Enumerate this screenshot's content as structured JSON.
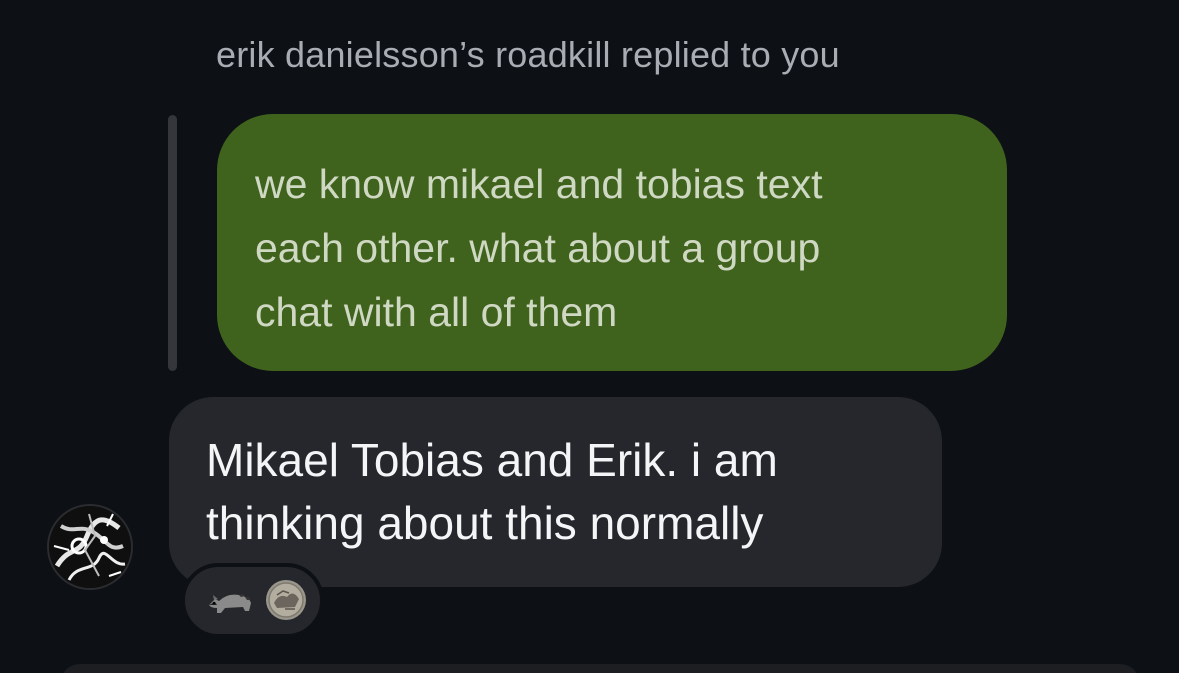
{
  "reply": {
    "header": "erik danielsson’s roadkill replied to you",
    "quoted_lines": [
      "we know mikael and tobias text",
      "each other. what about a group",
      "chat with all of them"
    ]
  },
  "message": {
    "lines": [
      "Mikael Tobias and Erik. i am",
      "thinking about this normally"
    ]
  },
  "avatar": {
    "icon": "user-avatar-icon"
  },
  "reactions": [
    {
      "icon": "raccoon-emoji-icon"
    },
    {
      "icon": "coin-emoji-icon"
    }
  ],
  "colors": {
    "background": "#0d1015",
    "quoted_bubble": "#3f631d",
    "message_bubble": "#25272c",
    "header_text": "#a9acb3"
  }
}
